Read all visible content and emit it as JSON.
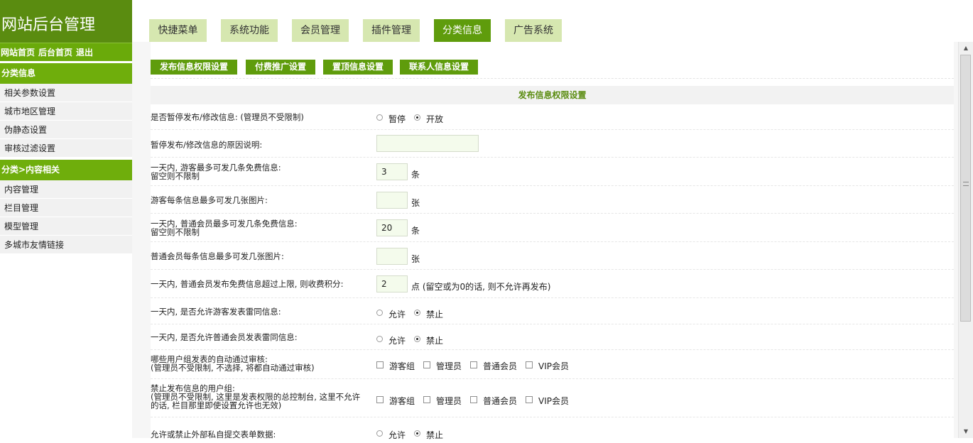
{
  "sidebar": {
    "logo": "网站后台管理",
    "top_links": [
      "网站首页",
      "后台首页",
      "退出"
    ],
    "groups": [
      {
        "title": "分类信息",
        "items": [
          "相关参数设置",
          "城市地区管理",
          "伪静态设置",
          "审核过滤设置"
        ]
      },
      {
        "title": "分类>内容相关",
        "items": [
          "内容管理",
          "栏目管理",
          "模型管理",
          "多城市友情链接"
        ]
      }
    ]
  },
  "tabs": [
    "快捷菜单",
    "系统功能",
    "会员管理",
    "插件管理",
    "分类信息",
    "广告系统"
  ],
  "active_tab": "分类信息",
  "sub_buttons": [
    "发布信息权限设置",
    "付费推广设置",
    "置顶信息设置",
    "联系人信息设置"
  ],
  "section_title": "发布信息权限设置",
  "form": {
    "pause": {
      "label": "是否暂停发布/修改信息: (管理员不受限制)",
      "options": [
        "暂停",
        "开放"
      ],
      "selected": "开放"
    },
    "pause_reason": {
      "label": "暂停发布/修改信息的原因说明:",
      "value": ""
    },
    "guest_daily": {
      "label_line1": "一天内, 游客最多可发几条免费信息:",
      "label_line2": "留空则不限制",
      "value": "3",
      "unit": "条"
    },
    "guest_images": {
      "label": "游客每条信息最多可发几张图片:",
      "value": "",
      "unit": "张"
    },
    "member_daily": {
      "label_line1": "一天内, 普通会员最多可发几条免费信息:",
      "label_line2": "留空则不限制",
      "value": "20",
      "unit": "条"
    },
    "member_images": {
      "label": "普通会员每条信息最多可发几张图片:",
      "value": "",
      "unit": "张"
    },
    "member_overlimit": {
      "label": "一天内, 普通会员发布免费信息超过上限, 则收费积分:",
      "value": "2",
      "unit": "点 (留空或为0的话, 则不允许再发布)"
    },
    "guest_duplicate": {
      "label": "一天内, 是否允许游客发表雷同信息:",
      "options": [
        "允许",
        "禁止"
      ],
      "selected": "禁止"
    },
    "member_duplicate": {
      "label": "一天内, 是否允许普通会员发表雷同信息:",
      "options": [
        "允许",
        "禁止"
      ],
      "selected": "禁止"
    },
    "auto_approve": {
      "label_line1": "哪些用户组发表的自动通过审核:",
      "label_line2": "(管理员不受限制, 不选择, 将都自动通过审核)",
      "options": [
        "游客组",
        "管理员",
        "普通会员",
        "VIP会员"
      ]
    },
    "forbid_groups": {
      "label_line1": "禁止发布信息的用户组:",
      "label_line2": "(管理员不受限制, 这里是发表权限的总控制台, 这里不允许",
      "label_line3": "的话, 栏目那里即使设置允许也无效)",
      "options": [
        "游客组",
        "管理员",
        "普通会员",
        "VIP会员"
      ]
    },
    "external_submit": {
      "label": "允许或禁止外部私自提交表单数据:",
      "options": [
        "允许",
        "禁止"
      ],
      "selected": "禁止"
    }
  },
  "colors": {
    "brand_dark": "#5a8c10",
    "brand": "#6aaa0a",
    "tab_inactive": "#d6e7b0",
    "input_bg": "#f4fbec"
  }
}
